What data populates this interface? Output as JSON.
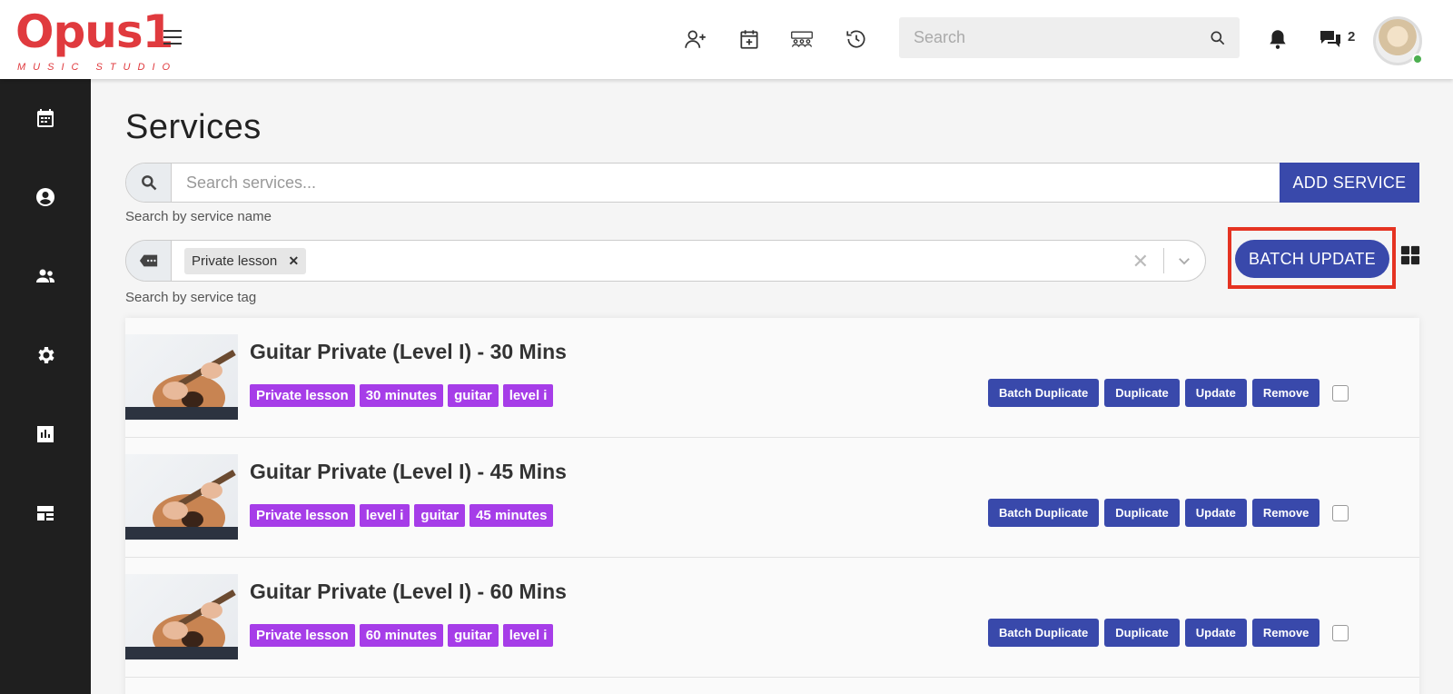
{
  "brand": {
    "logo_text": "Opus1",
    "logo_sub": "MUSIC STUDIO",
    "color": "#e03a3e"
  },
  "topbar": {
    "search_placeholder": "Search",
    "message_count": "2",
    "icons": [
      "add-user-icon",
      "calendar-plus-icon",
      "groups-icon",
      "history-icon",
      "search-icon",
      "bell-icon",
      "chat-icon"
    ]
  },
  "sidebar": {
    "items": [
      "calendar-icon",
      "account-icon",
      "people-icon",
      "settings-icon",
      "reports-icon",
      "dashboard-icon"
    ]
  },
  "page": {
    "title": "Services",
    "search_placeholder": "Search services...",
    "search_help": "Search by service name",
    "add_button": "ADD SERVICE",
    "tag_chip": "Private lesson",
    "tag_help": "Search by service tag",
    "batch_button": "BATCH UPDATE"
  },
  "actions": {
    "batch_duplicate": "Batch Duplicate",
    "duplicate": "Duplicate",
    "update": "Update",
    "remove": "Remove"
  },
  "services": [
    {
      "title": "Guitar Private (Level I) - 30 Mins",
      "tags": [
        "Private lesson",
        "30 minutes",
        "guitar",
        "level i"
      ]
    },
    {
      "title": "Guitar Private (Level I) - 45 Mins",
      "tags": [
        "Private lesson",
        "level i",
        "guitar",
        "45 minutes"
      ]
    },
    {
      "title": "Guitar Private (Level I) - 60 Mins",
      "tags": [
        "Private lesson",
        "60 minutes",
        "guitar",
        "level i"
      ]
    }
  ],
  "colors": {
    "accent": "#3949ab",
    "tag": "#a63de8",
    "highlight": "#e53322",
    "sidebar": "#1f1f1f"
  }
}
